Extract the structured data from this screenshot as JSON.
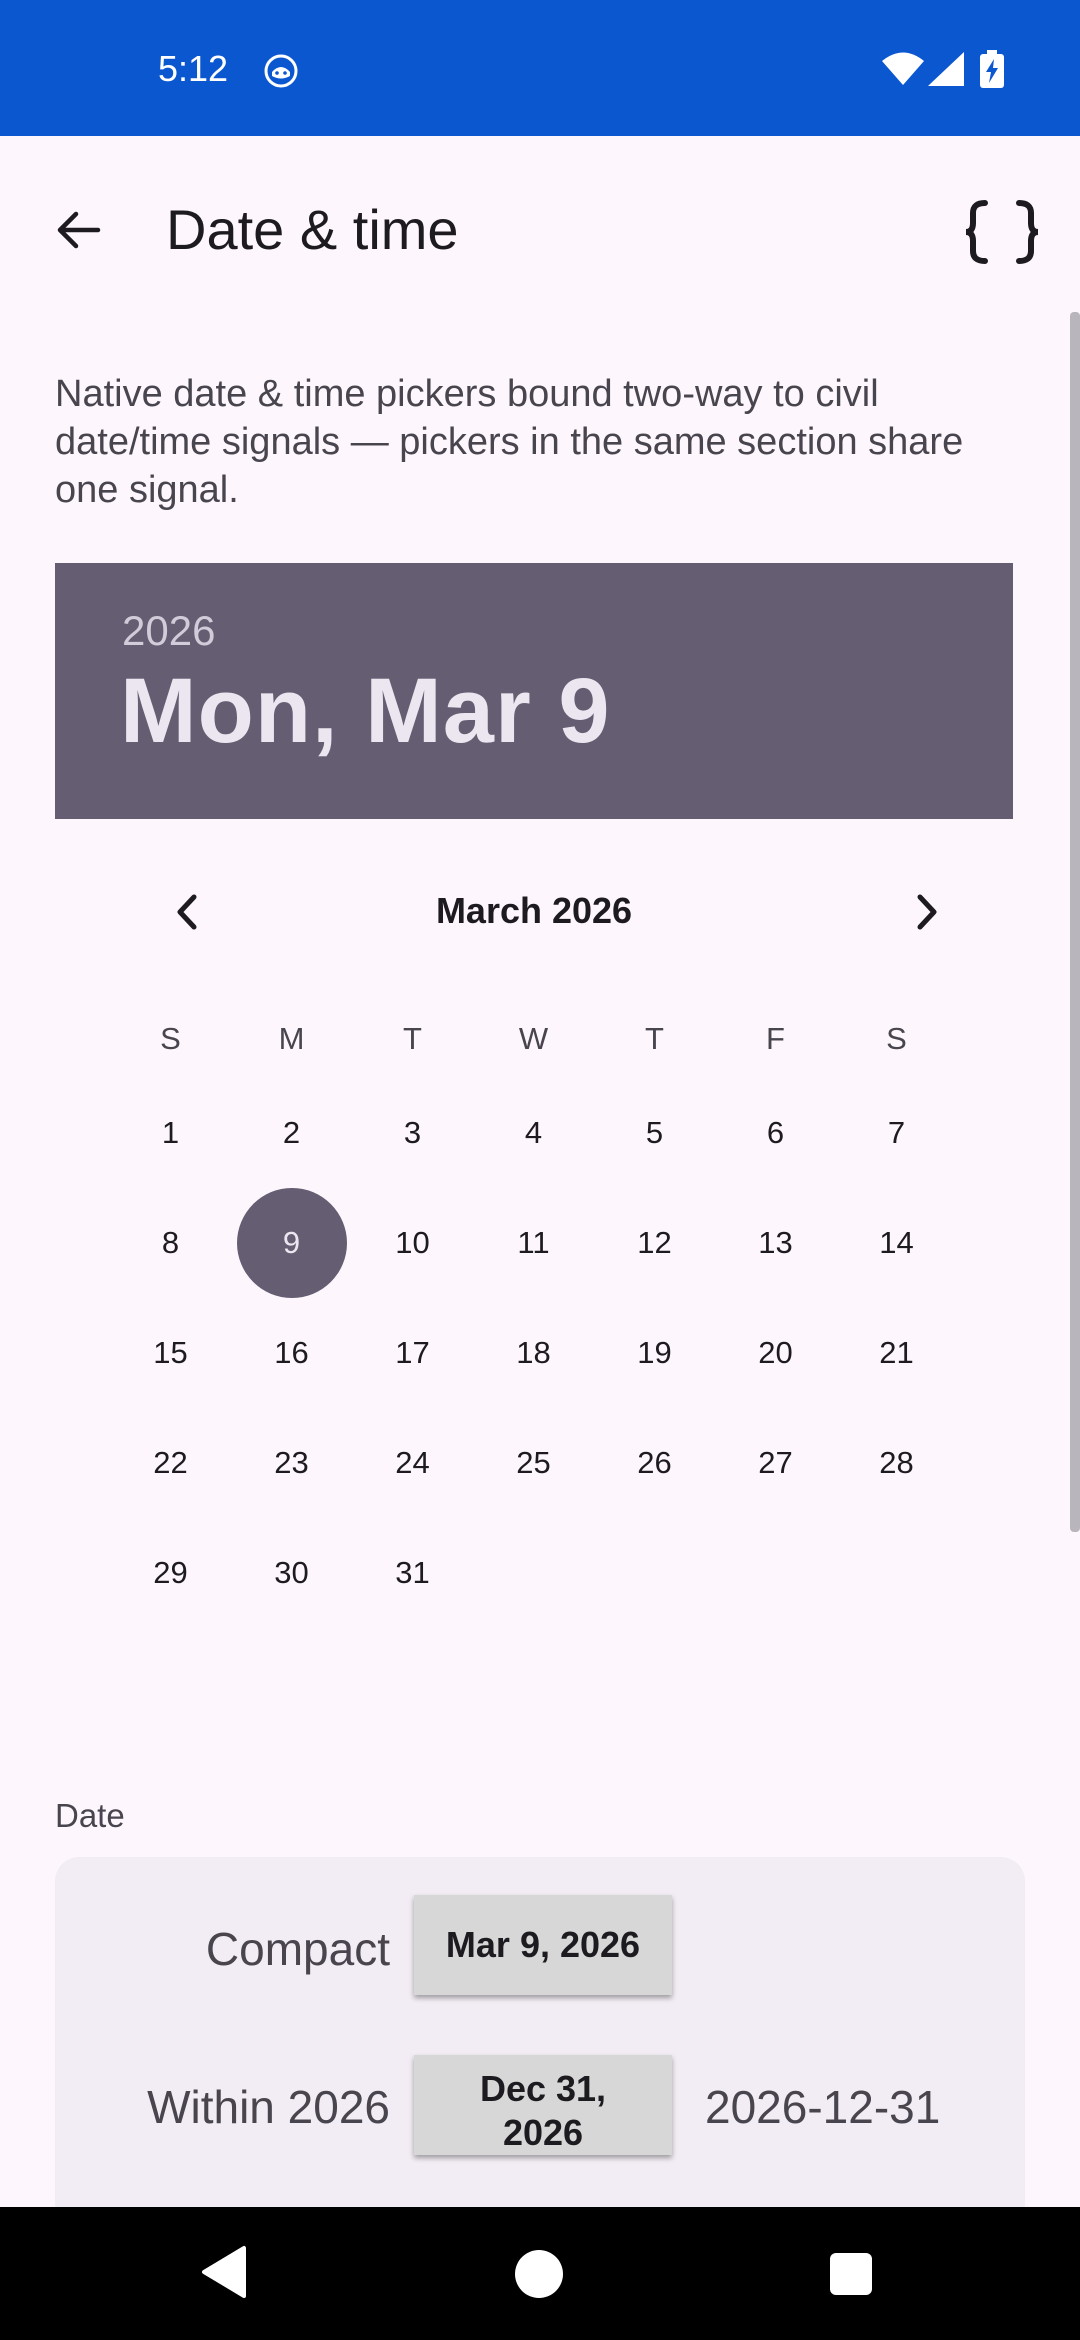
{
  "status_bar": {
    "time": "5:12"
  },
  "header": {
    "title": "Date & time"
  },
  "description": "Native date & time pickers bound two-way to civil date/time signals — pickers in the same section share one signal.",
  "picker": {
    "year": "2026",
    "selected_date": "Mon, Mar 9",
    "month_label": "March 2026",
    "weekdays": [
      "S",
      "M",
      "T",
      "W",
      "T",
      "F",
      "S"
    ],
    "weeks": [
      [
        "1",
        "2",
        "3",
        "4",
        "5",
        "6",
        "7"
      ],
      [
        "8",
        "9",
        "10",
        "11",
        "12",
        "13",
        "14"
      ],
      [
        "15",
        "16",
        "17",
        "18",
        "19",
        "20",
        "21"
      ],
      [
        "22",
        "23",
        "24",
        "25",
        "26",
        "27",
        "28"
      ],
      [
        "29",
        "30",
        "31",
        "",
        "",
        "",
        ""
      ]
    ],
    "selected_day": "9"
  },
  "date_section": {
    "label": "Date",
    "rows": [
      {
        "label": "Compact",
        "value": "Mar 9, 2026",
        "iso": ""
      },
      {
        "label": "Within 2026",
        "value": "Dec 31, 2026",
        "iso": "2026-12-31"
      }
    ]
  },
  "colors": {
    "status_bar": "#0b57d0",
    "accent": "#655d72",
    "background": "#fdf7fd"
  }
}
